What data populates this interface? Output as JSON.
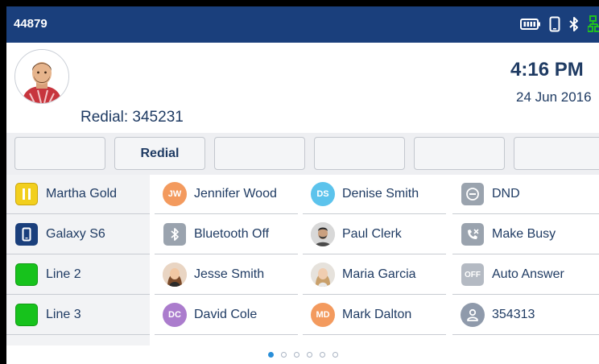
{
  "statusbar": {
    "extension": "44879",
    "icons": [
      "battery-icon",
      "phone-device-icon",
      "bluetooth-icon",
      "network-icon"
    ],
    "bg_color": "#1a3f7c"
  },
  "user": {
    "avatar": "user-avatar",
    "redial_text": "Redial: 345231"
  },
  "clock": {
    "time": "4:16 PM",
    "date": "24 Jun 2016"
  },
  "softkeys": [
    "",
    "Redial",
    "",
    "",
    "",
    ""
  ],
  "keys": {
    "col1": [
      {
        "label": "Martha Gold",
        "icon": "busy-lamp-icon",
        "color": "#f2cf1d"
      },
      {
        "label": "Galaxy S6",
        "icon": "mobile-phone-icon",
        "color": "#1a3f7c"
      },
      {
        "label": "Line 2",
        "icon": "line-status-icon",
        "color": "#17c21c"
      },
      {
        "label": "Line 3",
        "icon": "line-status-icon",
        "color": "#17c21c"
      }
    ],
    "col2": [
      {
        "label": "Jennifer Wood",
        "icon": "initials-avatar",
        "initials": "JW",
        "color": "#f39a5e"
      },
      {
        "label": "Bluetooth Off",
        "icon": "bluetooth-icon",
        "color": "#9aa3ae"
      },
      {
        "label": "Jesse Smith",
        "icon": "photo-avatar",
        "color": "#b98c63"
      },
      {
        "label": "David Cole",
        "icon": "initials-avatar",
        "initials": "DC",
        "color": "#ab7ccd"
      }
    ],
    "col3": [
      {
        "label": "Denise Smith",
        "icon": "initials-avatar",
        "initials": "DS",
        "color": "#5cc3ec"
      },
      {
        "label": "Paul Clerk",
        "icon": "photo-avatar",
        "color": "#6b6b6b"
      },
      {
        "label": "Maria Garcia",
        "icon": "photo-avatar",
        "color": "#c7a27b"
      },
      {
        "label": "Mark Dalton",
        "icon": "initials-avatar",
        "initials": "MD",
        "color": "#f39a5e"
      }
    ],
    "col4": [
      {
        "label": "DND",
        "icon": "dnd-icon",
        "color": "#9aa3ae"
      },
      {
        "label": "Make Busy",
        "icon": "make-busy-icon",
        "color": "#9aa3ae"
      },
      {
        "label": "Auto Answer",
        "icon": "auto-answer-icon",
        "badge": "OFF",
        "color": "#b4bac3"
      },
      {
        "label": "354313",
        "icon": "contact-icon",
        "color": "#8f9aab"
      }
    ]
  },
  "pager": {
    "pages": 6,
    "active": 1
  }
}
